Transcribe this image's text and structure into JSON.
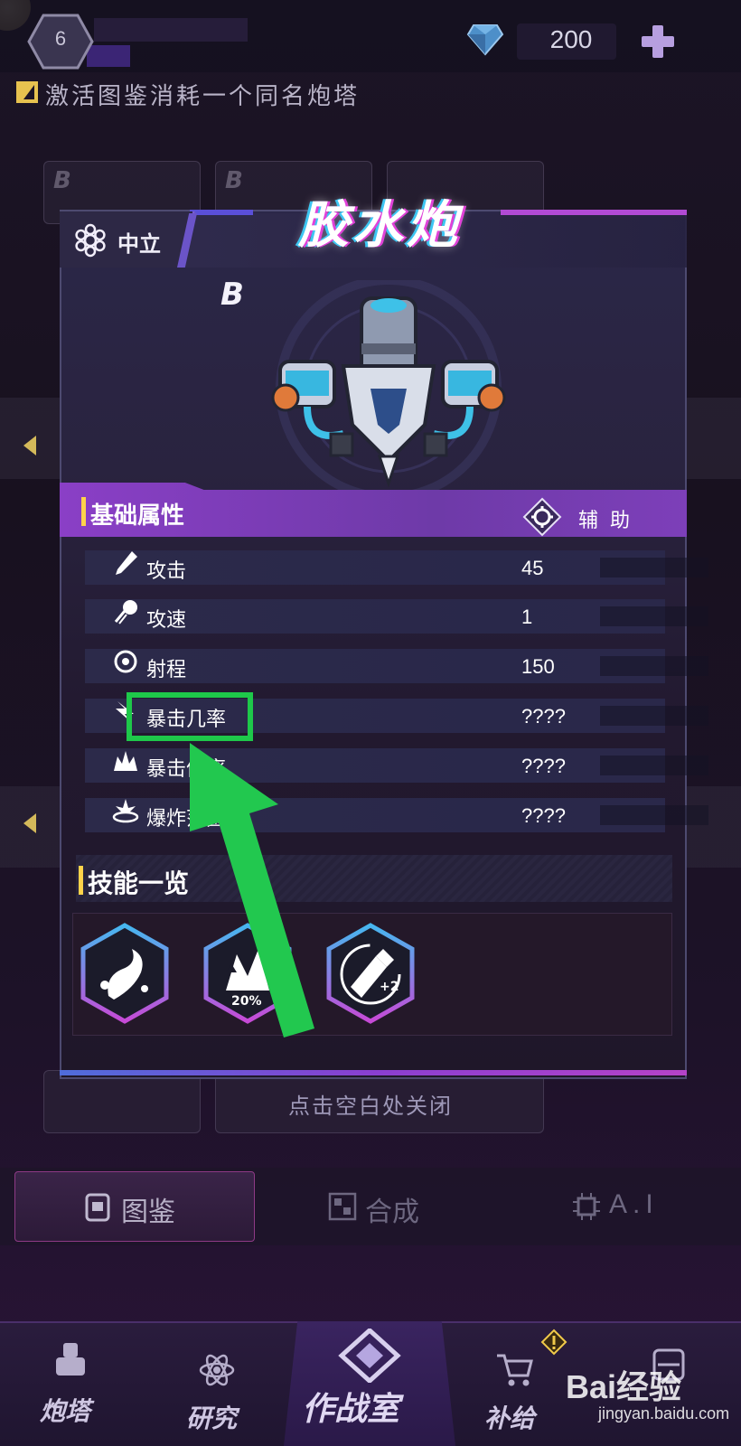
{
  "top_bar": {
    "level": "6",
    "gems": "200"
  },
  "hint": {
    "text": "激活图鉴消耗一个同名炮塔"
  },
  "modal": {
    "faction": "中立",
    "name": "胶水炮",
    "rank": "B",
    "section_title": "基础属性",
    "role": "辅 助",
    "stats": [
      {
        "label": "攻击",
        "value": "45",
        "icon": "sword-icon"
      },
      {
        "label": "攻速",
        "value": "1",
        "icon": "speed-icon"
      },
      {
        "label": "射程",
        "value": "150",
        "icon": "target-icon"
      },
      {
        "label": "暴击几率",
        "value": "????",
        "icon": "crit-chance-icon"
      },
      {
        "label": "暴击倍率",
        "value": "????",
        "icon": "crit-damage-icon"
      },
      {
        "label": "爆炸范围",
        "value": "????",
        "icon": "explosion-icon"
      }
    ],
    "skills_title": "技能一览",
    "skills": [
      {
        "icon": "glue-splash-icon"
      },
      {
        "icon": "attack-up-icon",
        "badge": "20%"
      },
      {
        "icon": "glue-bottle-icon",
        "badge": "+2"
      }
    ],
    "close_hint": "点击空白处关闭"
  },
  "bg_cards": {
    "rank": "B"
  },
  "tabs": [
    {
      "label": "图鉴",
      "active": true
    },
    {
      "label": "合成",
      "active": false
    },
    {
      "label": "A.I",
      "active": false
    }
  ],
  "bottom_nav": [
    {
      "label": "炮塔"
    },
    {
      "label": "研究"
    },
    {
      "label": "作战室"
    },
    {
      "label": "补给"
    },
    {
      "label": ""
    }
  ],
  "watermark": {
    "logo": "Bai经验",
    "url": "jingyan.baidu.com"
  },
  "colors": {
    "accent_purple": "#8a3fc6",
    "highlight_green": "#1ec84a",
    "gold": "#ffd34a"
  }
}
